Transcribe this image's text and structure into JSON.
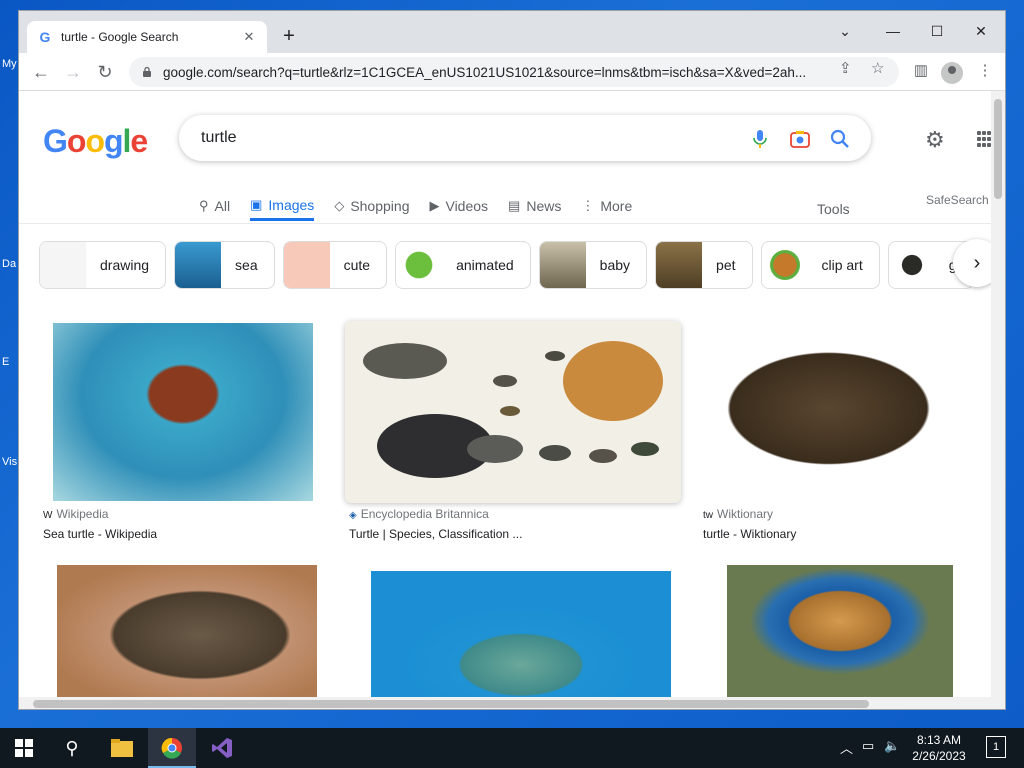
{
  "desktop": {
    "side_labels": [
      "My",
      "Da",
      "E",
      "Vis"
    ]
  },
  "browser": {
    "tab_title": "turtle - Google Search",
    "url": "google.com/search?q=turtle&rlz=1C1GCEA_enUS1021US1021&source=lnms&tbm=isch&sa=X&ved=2ah..."
  },
  "search": {
    "logo": [
      "G",
      "o",
      "o",
      "g",
      "l",
      "e"
    ],
    "logo_colors": [
      "#4285f4",
      "#ea4335",
      "#fbbc05",
      "#4285f4",
      "#34a853",
      "#ea4335"
    ],
    "query": "turtle"
  },
  "nav": {
    "tabs": [
      {
        "label": "All",
        "icon": "search-icon"
      },
      {
        "label": "Images",
        "icon": "image-icon"
      },
      {
        "label": "Shopping",
        "icon": "tag-icon"
      },
      {
        "label": "Videos",
        "icon": "play-icon"
      },
      {
        "label": "News",
        "icon": "news-icon"
      },
      {
        "label": "More",
        "icon": "more-vert-icon"
      }
    ],
    "tools": "Tools",
    "safesearch": "SafeSearch"
  },
  "chips": [
    {
      "label": "drawing",
      "color": "#f5f5f5"
    },
    {
      "label": "sea",
      "color": "#2a7fb0"
    },
    {
      "label": "cute",
      "color": "#f7c9b8"
    },
    {
      "label": "animated",
      "color": "#6cbf3c"
    },
    {
      "label": "baby",
      "color": "#9c8f6a"
    },
    {
      "label": "pet",
      "color": "#6b5a3a"
    },
    {
      "label": "clip art",
      "color": "#5cae3e"
    },
    {
      "label": "g",
      "color": "#e8e4dc"
    }
  ],
  "results": [
    {
      "source": "Wikipedia",
      "source_icon": "W",
      "title": "Sea turtle - Wikipedia",
      "colors": [
        "#1f8fb0",
        "#7a3b1e"
      ]
    },
    {
      "source": "Encyclopedia Britannica",
      "source_icon": "◈",
      "title": "Turtle | Species, Classification ...",
      "colors": [
        "#f2efe6",
        "#4a4a48"
      ]
    },
    {
      "source": "Wiktionary",
      "source_icon": "tw",
      "title": "turtle - Wiktionary",
      "colors": [
        "#ffffff",
        "#4a3a26"
      ]
    },
    {
      "source": "",
      "source_icon": "",
      "title": "",
      "colors": [
        "#b08060",
        "#7a6a50"
      ]
    },
    {
      "source": "",
      "source_icon": "",
      "title": "",
      "colors": [
        "#1c8fd4",
        "#5aa7a0"
      ]
    },
    {
      "source": "",
      "source_icon": "",
      "title": "",
      "colors": [
        "#1a5fa8",
        "#c4883e"
      ]
    }
  ],
  "taskbar": {
    "time": "8:13 AM",
    "date": "2/26/2023",
    "notification_count": "1"
  }
}
